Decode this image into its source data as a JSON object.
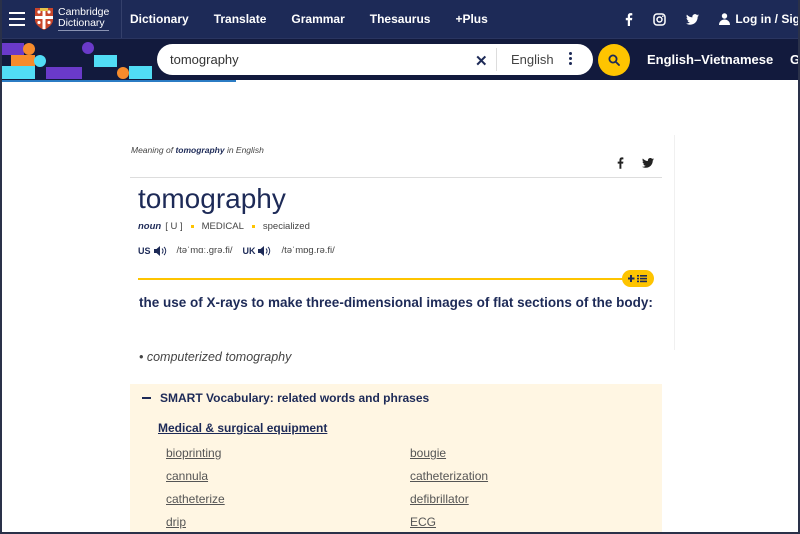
{
  "header": {
    "logo_line1": "Cambridge",
    "logo_line2": "Dictionary",
    "nav": [
      "Dictionary",
      "Translate",
      "Grammar",
      "Thesaurus",
      "+Plus"
    ],
    "login_label": "Log in / Sig",
    "social_icons": [
      "facebook-icon",
      "instagram-icon",
      "twitter-icon"
    ]
  },
  "search": {
    "value": "tomography",
    "language": "English",
    "dictionary_link": "English–Vietnamese",
    "next_link_partial": "G"
  },
  "colors": {
    "nav_bg": "#1d2a57",
    "band_bg": "#121a3d",
    "accent_yellow": "#fec400",
    "smart_bg": "#fff6e3",
    "text_dark": "#1d2a57"
  },
  "entry": {
    "meaning_prefix": "Meaning of",
    "meaning_word": "tomography",
    "meaning_suffix": "in English",
    "headword": "tomography",
    "pos": "noun",
    "grammar": "[ U ]",
    "domain": "MEDICAL",
    "register": "specialized",
    "us_label": "US",
    "us_ipa": "/təˈmɑː.ɡrə.fi/",
    "uk_label": "UK",
    "uk_ipa": "/təˈmɒɡ.rə.fi/",
    "definition": "the use of X-rays to make three-dimensional images of flat sections of the body:",
    "example": "• computerized tomography"
  },
  "smart_vocab": {
    "title": "SMART Vocabulary: related words and phrases",
    "category": "Medical & surgical equipment",
    "words": [
      "bioprinting",
      "bougie",
      "cannula",
      "catheterization",
      "catheterize",
      "defibrillator",
      "drip",
      "ECG"
    ]
  }
}
